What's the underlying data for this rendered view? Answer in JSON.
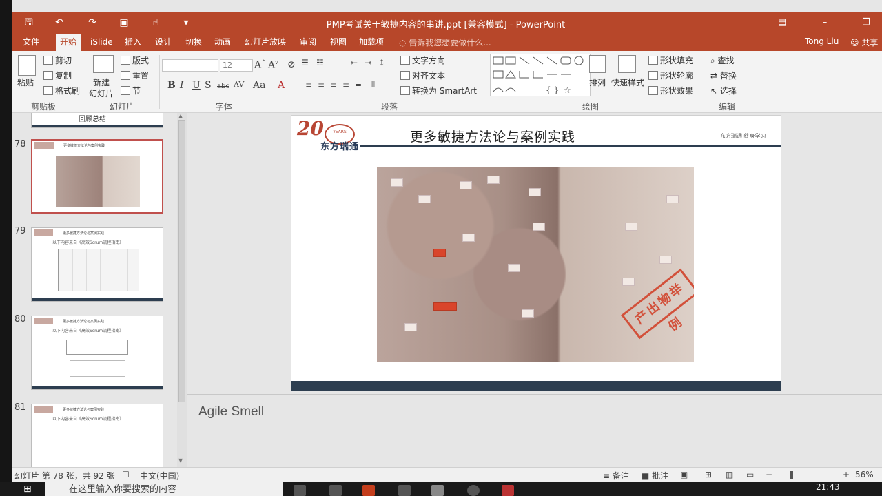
{
  "window": {
    "title": "PMP考试关于敏捷内容的串讲.ppt [兼容模式] - PowerPoint"
  },
  "tabs": [
    "文件",
    "开始",
    "iSlide",
    "插入",
    "设计",
    "切换",
    "动画",
    "幻灯片放映",
    "审阅",
    "视图",
    "加载项"
  ],
  "tellme": "告诉我您想要做什么...",
  "user": "Tong Liu",
  "share": "共享",
  "ribbon": {
    "paste": "粘贴",
    "cut": "剪切",
    "copy": "复制",
    "format_painter": "格式刷",
    "new_slide_1": "新建",
    "new_slide_2": "幻灯片",
    "layout": "版式",
    "reset": "重置",
    "section": "节",
    "font_size": "12",
    "text_direction": "文字方向",
    "align_text": "对齐文本",
    "convert_smartart": "转换为 SmartArt",
    "arrange": "排列",
    "quick_styles": "快速样式",
    "shape_fill": "形状填充",
    "shape_outline": "形状轮廓",
    "shape_effects": "形状效果",
    "find": "查找",
    "replace": "替换",
    "select": "选择",
    "groups": {
      "clipboard": "剪贴板",
      "slides": "幻灯片",
      "font": "字体",
      "paragraph": "段落",
      "drawing": "绘图",
      "editing": "编辑"
    }
  },
  "thumbnails": {
    "partial_title": "回顾总结",
    "items": [
      {
        "num": "78",
        "title": "更多敏捷方法论与案例实践",
        "sub": ""
      },
      {
        "num": "79",
        "title": "更多敏捷方法论与案例实践",
        "sub": "以下内容来自《高效Scrum流程指南》"
      },
      {
        "num": "80",
        "title": "更多敏捷方法论与案例实践",
        "sub": "以下内容来自《高效Scrum流程指南》"
      },
      {
        "num": "81",
        "title": "更多敏捷方法论与案例实践",
        "sub": "以下内容来自《高效Scrum流程指南》"
      }
    ]
  },
  "slide": {
    "logo_number": "20",
    "logo_badge": "YEARS",
    "logo_name": "东方瑞通",
    "title": "更多敏捷方法论与案例实践",
    "tag": "东方瑞通  终身学习",
    "stamp": "产出物举例"
  },
  "notes": "Agile Smell",
  "status": {
    "slide_info": "幻灯片 第 78 张，共 92 张",
    "language": "中文(中国)",
    "notes_btn": "备注",
    "comments_btn": "批注",
    "zoom": "56%"
  },
  "taskbar": {
    "search": "在这里输入你要搜索的内容",
    "time": "21:43"
  },
  "colors": {
    "accent": "#b7472a",
    "slide_bar": "#2d3e50",
    "stamp": "#d2503a"
  }
}
